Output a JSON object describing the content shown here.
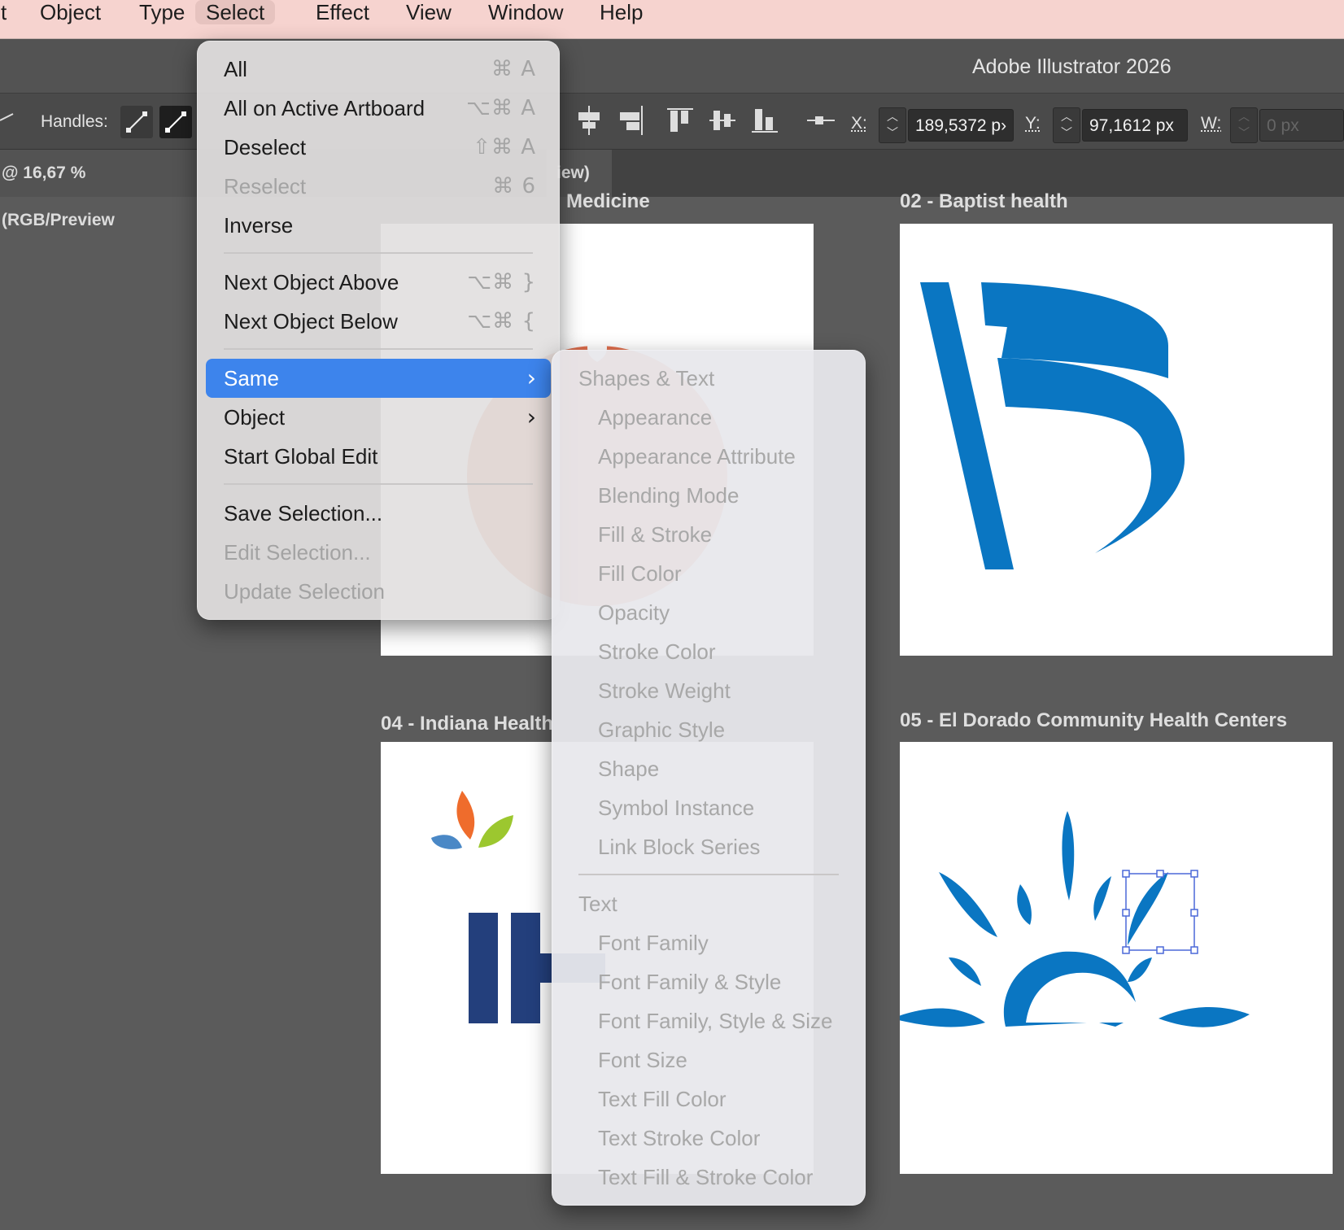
{
  "menubar": {
    "items": [
      "t",
      "Object",
      "Type",
      "Select",
      "Effect",
      "View",
      "Window",
      "Help"
    ]
  },
  "app_title": "Adobe Illustrator 2026",
  "controlbar": {
    "handles_label": "Handles:",
    "x_label": "X:",
    "x_value": "189,5372 p›",
    "y_label": "Y:",
    "y_value": "97,1612 px",
    "w_label": "W:",
    "w_value": "0 px"
  },
  "tabs": {
    "doc1": "@ 16,67 % (RGB/Preview",
    "doc2": "iew)"
  },
  "artboards": {
    "ab1_label": "Medicine",
    "ab2_label": "02 - Baptist health",
    "ab4_label": "04 - Indiana Health",
    "ab5_label": "05 - El Dorado Community Health Centers"
  },
  "select_menu": {
    "all": {
      "label": "All",
      "shortcut": "⌘ A"
    },
    "all_artboard": {
      "label": "All on Active Artboard",
      "shortcut": "⌥⌘ A"
    },
    "deselect": {
      "label": "Deselect",
      "shortcut": "⇧⌘ A"
    },
    "reselect": {
      "label": "Reselect",
      "shortcut": "⌘ 6"
    },
    "inverse": {
      "label": "Inverse"
    },
    "next_above": {
      "label": "Next Object Above",
      "shortcut": "⌥⌘ }"
    },
    "next_below": {
      "label": "Next Object Below",
      "shortcut": "⌥⌘ {"
    },
    "same": {
      "label": "Same",
      "chevron": "›"
    },
    "object": {
      "label": "Object",
      "chevron": "›"
    },
    "global_edit": {
      "label": "Start Global Edit"
    },
    "save_selection": {
      "label": "Save Selection..."
    },
    "edit_selection": {
      "label": "Edit Selection..."
    },
    "update_selection": {
      "label": "Update Selection"
    }
  },
  "same_submenu": {
    "shapes_header": "Shapes & Text",
    "shapes_items": [
      "Appearance",
      "Appearance Attribute",
      "Blending Mode",
      "Fill & Stroke",
      "Fill Color",
      "Opacity",
      "Stroke Color",
      "Stroke Weight",
      "Graphic Style",
      "Shape",
      "Symbol Instance",
      "Link Block Series"
    ],
    "text_header": "Text",
    "text_items": [
      "Font Family",
      "Font Family & Style",
      "Font Family, Style & Size",
      "Font Size",
      "Text Fill Color",
      "Text Stroke Color",
      "Text Fill & Stroke Color"
    ]
  },
  "colors": {
    "menubar_bg": "#f6d3cf",
    "highlight": "#3d84ec",
    "baptist_blue": "#0a76c2",
    "indiana_navy": "#233f7c",
    "leaf_orange": "#ef6c2c",
    "leaf_green": "#9cc72f",
    "leaf_blue": "#4a88c6",
    "medicine_orange": "#e0704f"
  }
}
